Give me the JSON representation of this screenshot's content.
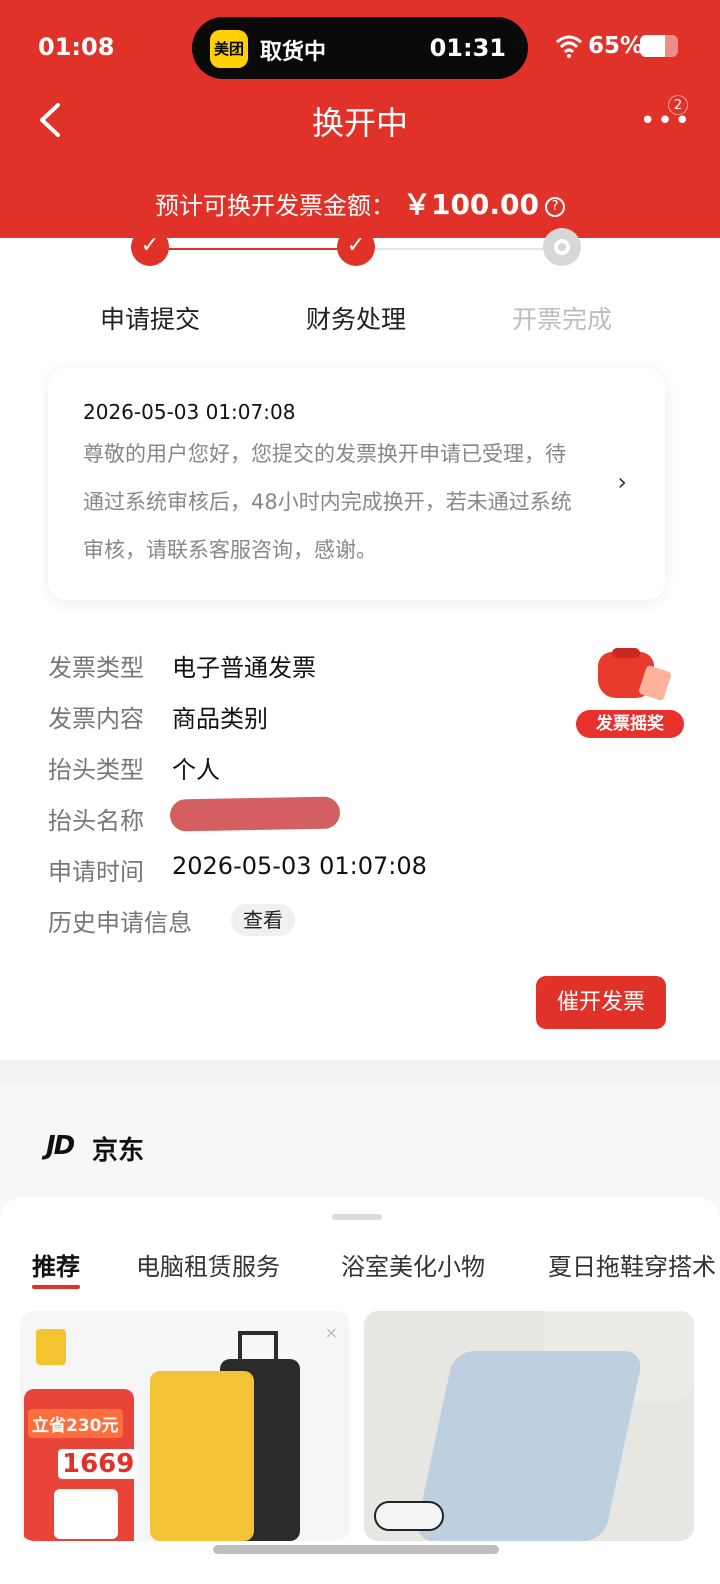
{
  "status_bar": {
    "time": "01:08",
    "live_activity": {
      "app_badge": "美团",
      "label": "取货中",
      "time": "01:31"
    },
    "battery_percent": "65%",
    "battery_level": 0.65
  },
  "header": {
    "title": "换开中",
    "more_badge": "2",
    "amount_label": "预计可换开发票金额：",
    "amount_value": "￥100.00",
    "help_icon": "?"
  },
  "steps": [
    {
      "label": "申请提交",
      "done": true
    },
    {
      "label": "财务处理",
      "done": true
    },
    {
      "label": "开票完成",
      "done": false
    }
  ],
  "notice": {
    "timestamp": "2026-05-03 01:07:08",
    "message": "尊敬的用户您好，您提交的发票换开申请已受理，待通过系统审核后，48小时内完成换开，若未通过系统审核，请联系客服咨询，感谢。",
    "chevron": "›"
  },
  "invoice_info": {
    "type": {
      "label": "发票类型",
      "value": "电子普通发票"
    },
    "content": {
      "label": "发票内容",
      "value": "商品类别"
    },
    "title_type": {
      "label": "抬头类型",
      "value": "个人"
    },
    "title_name": {
      "label": "抬头名称",
      "value": ""
    },
    "apply_time": {
      "label": "申请时间",
      "value": "2026-05-03 01:07:08"
    },
    "history": {
      "label": "历史申请信息",
      "button": "查看"
    }
  },
  "lottery_badge": "发票摇奖",
  "urge_button": "催开发票",
  "jd": {
    "logo": "JD",
    "name": "京东",
    "tabs": [
      "推荐",
      "电脑租赁服务",
      "浴室美化小物",
      "夏日拖鞋穿搭术"
    ],
    "close_mark": "×",
    "product1": {
      "promo_save": "立省230元",
      "promo_price": "1669"
    }
  },
  "colors": {
    "brand_red": "#e1322a"
  }
}
